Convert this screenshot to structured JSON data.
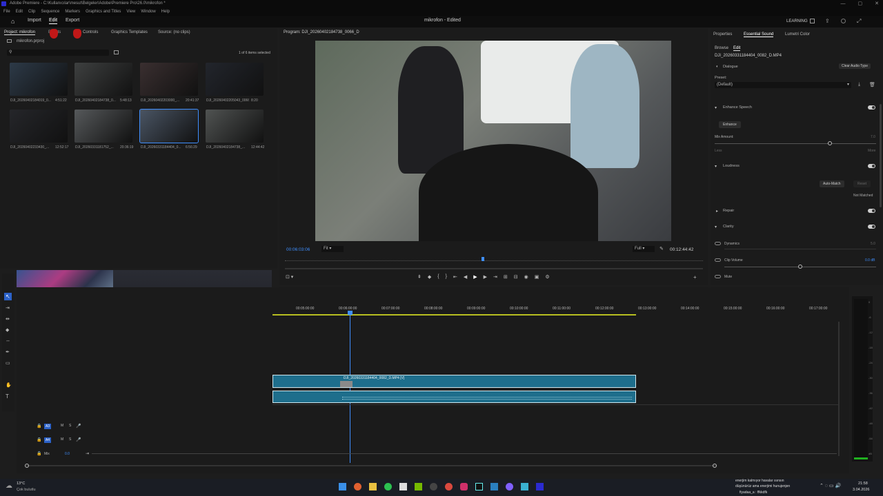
{
  "titlebar": {
    "title": "Adobe Premiere - C:\\Kullanıcılar\\mesut\\Belgeler\\Adobe\\Premiere Pro\\26.0\\mikrofon *",
    "controls": [
      "—",
      "▢",
      "✕"
    ]
  },
  "menu": [
    "File",
    "Edit",
    "Clip",
    "Sequence",
    "Markers",
    "Graphics and Titles",
    "View",
    "Window",
    "Help"
  ],
  "header": {
    "tabs": [
      "Import",
      "Edit",
      "Export"
    ],
    "active_tab": "Edit",
    "doc_title": "mikrofon - Edited",
    "workspace": "LEARNING"
  },
  "left_panel": {
    "tabs": [
      "Project: mikrofon",
      "Effects",
      "Controls",
      "Graphics Templates",
      "Source: (no clips)"
    ],
    "project_file": "mikrofon.prproj",
    "items_selected": "1 of 6 items selected",
    "clips": [
      {
        "name": "DJI_20260402184019_0...",
        "duration": "4:51:22",
        "color": "#2d3a48"
      },
      {
        "name": "DJI_20260402184738_0...",
        "duration": "5:48:13",
        "color": "#3e4040"
      },
      {
        "name": "DJI_20260402203000_...",
        "duration": "20:41:37",
        "color": "#3a2f30"
      },
      {
        "name": "DJI_20260402205043_0066...",
        "duration": "8:20",
        "color": "#22252c"
      },
      {
        "name": "DJI_20260402233430_...",
        "duration": "12:52:17",
        "color": "#25262a"
      },
      {
        "name": "DJI_20260331181752_...",
        "duration": "20:36:19",
        "color": "#56595b"
      },
      {
        "name": "DJI_20260331184404_0...",
        "duration": "6:56:29",
        "color": "#4a5564"
      },
      {
        "name": "DJI_20260402184738_...",
        "duration": "12:44:42",
        "color": "#505352"
      }
    ]
  },
  "program": {
    "title": "Program: DJI_20260402184738_0066_D",
    "timecode": "00:06:03:06",
    "fit": "Fit",
    "quality": "Full",
    "duration": "00:12:44:42",
    "playhead_fraction": 0.47
  },
  "essential_sound": {
    "tabs": [
      "Properties",
      "Essential Sound",
      "Lumetri Color"
    ],
    "subtabs": [
      "Browse",
      "Edit"
    ],
    "clip_name": "DJI_20260331184404_0082_D.MP4",
    "type": "Dialogue",
    "clear_button": "Clear Audio Type",
    "preset_label": "Preset:",
    "preset_value": "(Default)",
    "enhance_speech": "Enhance Speech",
    "enhance_button": "Enhance",
    "mix_amount": "Mix Amount:",
    "mix_value": "7.0",
    "less": "Less",
    "more": "More",
    "mix_fraction": 0.7,
    "loudness": "Loudness",
    "auto_match": "Auto-Match",
    "reset": "Reset",
    "not_matched": "Not Matched",
    "repair": "Repair",
    "clarity": "Clarity",
    "dynamics": "Dynamics",
    "dynamics_value": "5.0",
    "clip_volume": "Clip Volume",
    "clip_volume_value": "0.0 dB",
    "mute": "Mute"
  },
  "timeline": {
    "ruler": [
      "00:05:00:00",
      "00:06:00:00",
      "00:07:00:00",
      "00:08:00:00",
      "00:09:00:00",
      "00:10:00:00",
      "00:11:00:00",
      "00:12:00:00",
      "00:13:00:00",
      "00:14:00:00",
      "00:15:00:00",
      "00:16:00:00",
      "00:17:00:00"
    ],
    "video_clip": "DJI_20260331184404_0082_D.MP4 [V]",
    "tracks": [
      "A3",
      "A4",
      "Mix"
    ],
    "mix_value": "0.0",
    "meter_ticks": [
      "0",
      "-6",
      "-12",
      "-18",
      "-24",
      "-30",
      "-36",
      "-42",
      "-48",
      "-54",
      "dB"
    ]
  },
  "taskbar": {
    "weather_temp": "13°C",
    "weather_desc": "Çok bulutlu",
    "chat_line1": "enerjim kalmıyor havalar ısınsın",
    "chat_line2": "düşünürüz ama enerjimi hunujenjen",
    "chat_line3": "fiyadaa_a : ffkkdfk",
    "time": "21:58",
    "date": "3.04.2026"
  }
}
